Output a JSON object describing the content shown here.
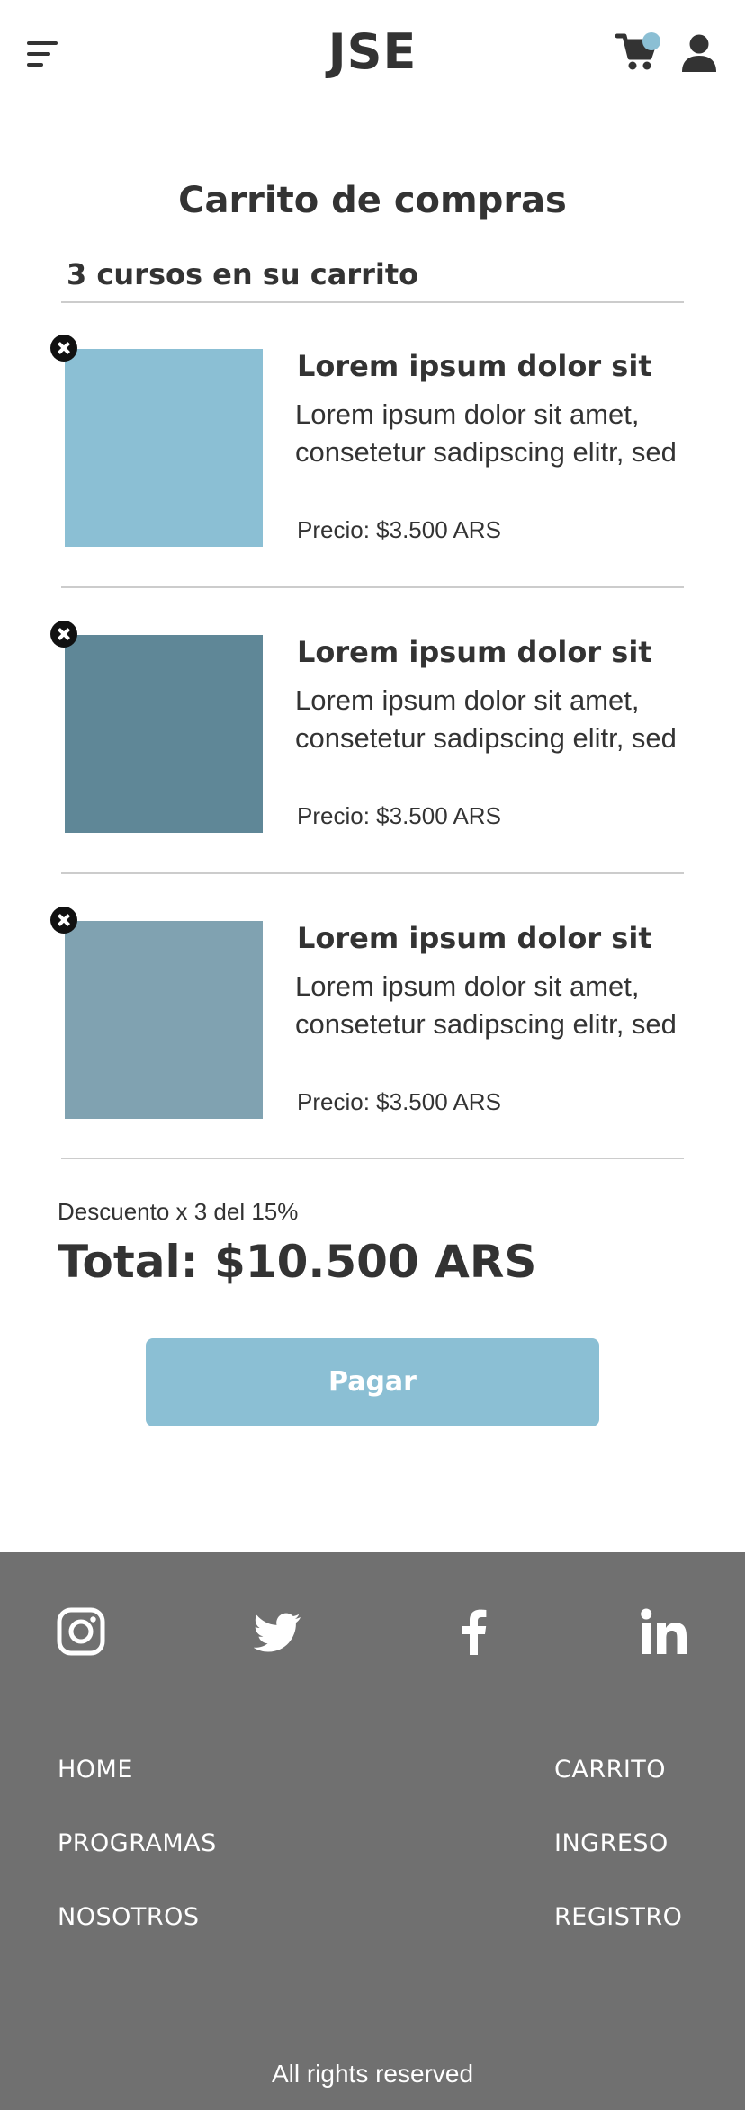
{
  "header": {
    "logo": "JSE",
    "icons": [
      "menu-icon",
      "cart-icon",
      "user-icon"
    ],
    "cart_indicator_color": "#8bbfd4"
  },
  "cart": {
    "title": "Carrito de compras",
    "count_label": "3 cursos en su carrito",
    "items": [
      {
        "title": "Lorem ipsum dolor sit",
        "description": "Lorem ipsum dolor sit amet, consetetur sadipscing elitr, sed",
        "price": "Precio: $3.500 ARS",
        "thumb_color": "#8bbfd4"
      },
      {
        "title": "Lorem ipsum dolor sit",
        "description": "Lorem ipsum dolor sit amet, consetetur sadipscing elitr, sed",
        "price": "Precio: $3.500 ARS",
        "thumb_color": "#5f8797"
      },
      {
        "title": "Lorem ipsum dolor sit",
        "description": "Lorem ipsum dolor sit amet, consetetur sadipscing elitr, sed",
        "price": "Precio: $3.500 ARS",
        "thumb_color": "#80a2b1"
      }
    ],
    "discount": "Descuento x 3 del 15%",
    "total": "Total: $10.500 ARS",
    "pay_label": "Pagar",
    "accent_color": "#8bbfd4"
  },
  "footer": {
    "background": "#707070",
    "social": [
      "instagram-icon",
      "twitter-icon",
      "facebook-icon",
      "linkedin-icon"
    ],
    "links_left": [
      "HOME",
      "PROGRAMAS",
      "NOSOTROS"
    ],
    "links_right": [
      "CARRITO",
      "INGRESO",
      "REGISTRO"
    ],
    "rights": "All rights reserved"
  }
}
